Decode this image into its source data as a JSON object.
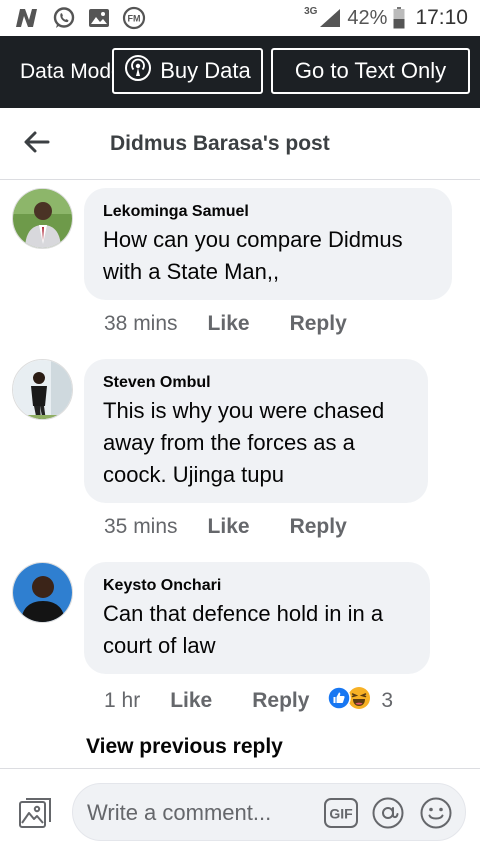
{
  "status_bar": {
    "network_type": "3G",
    "battery": "42%",
    "time": "17:10"
  },
  "data_bar": {
    "data_mode_label": "Data Mode",
    "buy_data_label": "Buy Data",
    "text_only_label": "Go to Text Only"
  },
  "header": {
    "title": "Didmus Barasa's post"
  },
  "comments": [
    {
      "name": "Lekominga Samuel",
      "text_lines": [
        "How can you compare Didmus",
        "with a State Man,,"
      ],
      "time": "38 mins",
      "like_label": "Like",
      "reply_label": "Reply"
    },
    {
      "name": "Steven Ombul",
      "text_lines": [
        "This is why you were chased",
        "away from the forces as a",
        "coock. Ujinga tupu"
      ],
      "time": "35 mins",
      "like_label": "Like",
      "reply_label": "Reply"
    },
    {
      "name": "Keysto Onchari",
      "text_lines": [
        "Can that defence hold in in a",
        "court of law"
      ],
      "time": "1 hr",
      "like_label": "Like",
      "reply_label": "Reply",
      "reaction_count": "3",
      "reaction_icons": [
        "like-reaction-icon",
        "haha-reaction-icon"
      ]
    }
  ],
  "view_previous_reply": "View previous reply",
  "composer": {
    "placeholder": "Write a comment...",
    "gif_label": "GIF"
  },
  "colors": {
    "dark_bar": "#1c2024",
    "bubble": "#f0f2f5",
    "secondary_text": "#65676b",
    "like_blue": "#1877f2",
    "haha_yellow": "#f7b125"
  }
}
